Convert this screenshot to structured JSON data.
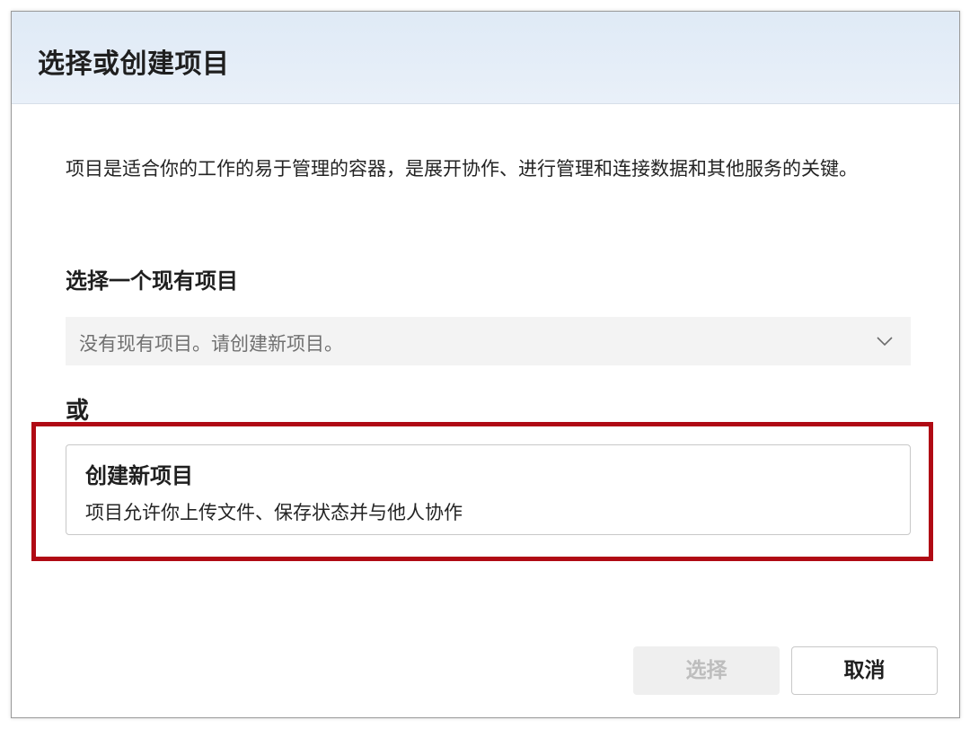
{
  "dialog": {
    "title": "选择或创建项目",
    "description": "项目是适合你的工作的易于管理的容器，是展开协作、进行管理和连接数据和其他服务的关键。",
    "existing_section_label": "选择一个现有项目",
    "existing_select": {
      "value": "没有现有项目。请创建新项目。",
      "icon": "chevron-down-icon"
    },
    "or_label": "或",
    "create_option": {
      "title": "创建新项目",
      "description": "项目允许你上传文件、保存状态并与他人协作"
    },
    "buttons": {
      "select_label": "选择",
      "cancel_label": "取消"
    }
  },
  "colors": {
    "header_background": "#e3edf8",
    "highlight_border": "#b00a14",
    "select_background": "#f3f3f3",
    "disabled_button_text": "#bdbdbd"
  }
}
